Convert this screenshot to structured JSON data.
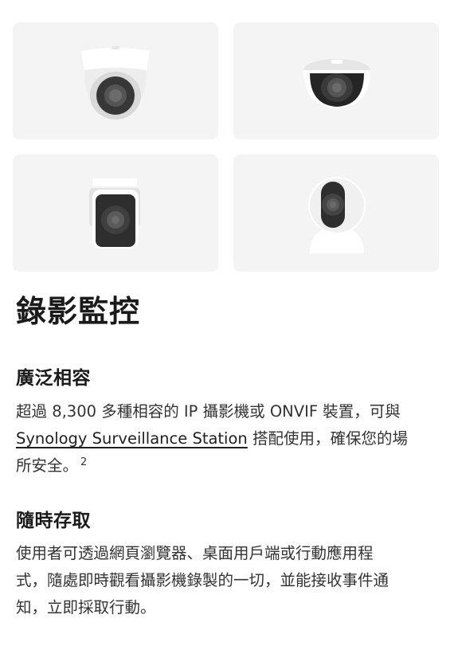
{
  "section": {
    "title": "錄影監控"
  },
  "cameras": [
    {
      "icon": "dome-turret-camera-icon"
    },
    {
      "icon": "dark-dome-camera-icon"
    },
    {
      "icon": "bullet-camera-icon"
    },
    {
      "icon": "pan-tilt-cube-camera-icon"
    }
  ],
  "features": [
    {
      "title": "廣泛相容",
      "line1": "超過 8,300 多種相容的 IP 攝影機或 ONVIF 裝置，可與",
      "link_text": "Synology Surveillance Station",
      "line2_rest": " 搭配使用，確保您的場",
      "line3": "所安全。",
      "footnote": "2"
    },
    {
      "title": "隨時存取",
      "line1": "使用者可透過網頁瀏覽器、桌面用戶端或行動應用程",
      "line2": "式，隨處即時觀看攝影機錄製的一切，並能接收事件通",
      "line3": "知，立即採取行動。"
    }
  ]
}
